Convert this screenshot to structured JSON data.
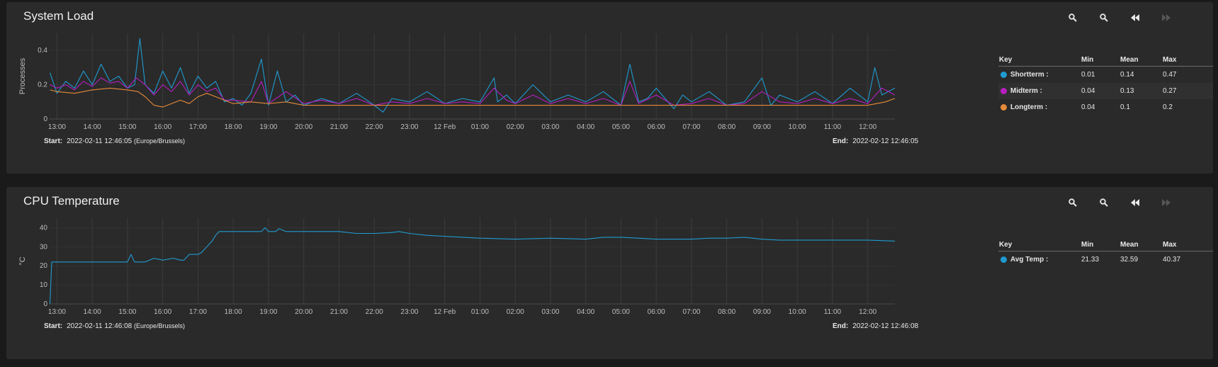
{
  "colors": {
    "shortterm": "#1f9bd1",
    "midterm": "#b61ec0",
    "longterm": "#e68a3a",
    "avgtemp": "#1f9bd1",
    "grid": "#3c3c3c",
    "axis_text": "#bdbdbd"
  },
  "toolbar_icons": [
    "zoom-in-icon",
    "zoom-out-icon",
    "rewind-icon",
    "forward-icon"
  ],
  "panels": [
    {
      "title": "System Load",
      "start_label": "Start:",
      "start_value": "2022-02-11 12:46:05",
      "start_tz": "(Europe/Brussels)",
      "end_label": "End:",
      "end_value": "2022-02-12 12:46:05",
      "legend": {
        "headers": [
          "Key",
          "Min",
          "Mean",
          "Max"
        ],
        "rows": [
          {
            "name": "Shortterm :",
            "min": "0.01",
            "mean": "0.14",
            "max": "0.47",
            "color": "#1f9bd1"
          },
          {
            "name": "Midterm :",
            "min": "0.04",
            "mean": "0.13",
            "max": "0.27",
            "color": "#b61ec0"
          },
          {
            "name": "Longterm :",
            "min": "0.04",
            "mean": "0.1",
            "max": "0.2",
            "color": "#e68a3a"
          }
        ]
      }
    },
    {
      "title": "CPU Temperature",
      "start_label": "Start:",
      "start_value": "2022-02-11 12:46:08",
      "start_tz": "(Europe/Brussels)",
      "end_label": "End:",
      "end_value": "2022-02-12 12:46:08",
      "legend": {
        "headers": [
          "Key",
          "Min",
          "Mean",
          "Max"
        ],
        "rows": [
          {
            "name": "Avg Temp :",
            "min": "21.33",
            "mean": "32.59",
            "max": "40.37",
            "color": "#1f9bd1"
          }
        ]
      }
    }
  ],
  "chart_data": [
    {
      "type": "line",
      "title": "System Load",
      "ylabel": "Processes",
      "ylim": [
        0,
        0.5
      ],
      "yticks": [
        0,
        0.2,
        0.4
      ],
      "ytick_labels": [
        "0",
        "0.2",
        "0.4"
      ],
      "xlim": [
        12.77,
        36.77
      ],
      "xticks": [
        13,
        14,
        15,
        16,
        17,
        18,
        19,
        20,
        21,
        22,
        23,
        24,
        25,
        26,
        27,
        28,
        29,
        30,
        31,
        32,
        33,
        34,
        35,
        36
      ],
      "xtick_labels": [
        "13:00",
        "14:00",
        "15:00",
        "16:00",
        "17:00",
        "18:00",
        "19:00",
        "20:00",
        "21:00",
        "22:00",
        "23:00",
        "12 Feb",
        "01:00",
        "02:00",
        "03:00",
        "04:00",
        "05:00",
        "06:00",
        "07:00",
        "08:00",
        "09:00",
        "10:00",
        "11:00",
        "12:00"
      ],
      "grid": "vertical",
      "series": [
        {
          "name": "Shortterm",
          "color": "#1f9bd1",
          "x": [
            12.8,
            13.0,
            13.25,
            13.5,
            13.75,
            14.0,
            14.25,
            14.5,
            14.75,
            15.0,
            15.2,
            15.35,
            15.5,
            15.75,
            16.0,
            16.25,
            16.5,
            16.75,
            17.0,
            17.25,
            17.5,
            17.75,
            18.0,
            18.25,
            18.5,
            18.8,
            19.0,
            19.25,
            19.5,
            19.75,
            20.0,
            20.5,
            21.0,
            21.5,
            22.0,
            22.25,
            22.5,
            23.0,
            23.5,
            24.0,
            24.5,
            25.0,
            25.4,
            25.5,
            25.75,
            26.0,
            26.5,
            27.0,
            27.5,
            28.0,
            28.5,
            29.0,
            29.25,
            29.5,
            29.75,
            30.0,
            30.5,
            30.75,
            31.0,
            31.5,
            32.0,
            32.5,
            33.0,
            33.25,
            33.5,
            34.0,
            34.5,
            35.0,
            35.5,
            36.0,
            36.2,
            36.4,
            36.77
          ],
          "y": [
            0.27,
            0.15,
            0.22,
            0.18,
            0.28,
            0.2,
            0.32,
            0.22,
            0.25,
            0.18,
            0.2,
            0.47,
            0.2,
            0.15,
            0.28,
            0.18,
            0.3,
            0.15,
            0.25,
            0.18,
            0.22,
            0.1,
            0.12,
            0.08,
            0.15,
            0.35,
            0.08,
            0.28,
            0.1,
            0.14,
            0.08,
            0.12,
            0.09,
            0.15,
            0.08,
            0.04,
            0.12,
            0.1,
            0.16,
            0.09,
            0.12,
            0.1,
            0.24,
            0.1,
            0.14,
            0.09,
            0.2,
            0.1,
            0.14,
            0.1,
            0.16,
            0.08,
            0.32,
            0.1,
            0.12,
            0.18,
            0.06,
            0.14,
            0.1,
            0.16,
            0.08,
            0.1,
            0.24,
            0.08,
            0.14,
            0.1,
            0.16,
            0.09,
            0.18,
            0.1,
            0.3,
            0.14,
            0.18
          ]
        },
        {
          "name": "Midterm",
          "color": "#b61ec0",
          "x": [
            12.8,
            13.0,
            13.25,
            13.5,
            13.75,
            14.0,
            14.25,
            14.5,
            14.75,
            15.0,
            15.25,
            15.5,
            15.75,
            16.0,
            16.25,
            16.5,
            16.75,
            17.0,
            17.25,
            17.5,
            17.75,
            18.0,
            18.5,
            18.8,
            19.0,
            19.5,
            20.0,
            20.5,
            21.0,
            21.5,
            22.0,
            22.5,
            23.0,
            23.5,
            24.0,
            24.5,
            25.0,
            25.4,
            25.75,
            26.0,
            26.5,
            27.0,
            27.5,
            28.0,
            28.5,
            29.0,
            29.25,
            29.5,
            30.0,
            30.5,
            31.0,
            31.5,
            32.0,
            32.5,
            33.0,
            33.5,
            34.0,
            34.5,
            35.0,
            35.5,
            36.0,
            36.4,
            36.77
          ],
          "y": [
            0.2,
            0.18,
            0.2,
            0.17,
            0.22,
            0.19,
            0.24,
            0.21,
            0.22,
            0.18,
            0.24,
            0.2,
            0.14,
            0.2,
            0.16,
            0.22,
            0.14,
            0.2,
            0.16,
            0.18,
            0.11,
            0.11,
            0.1,
            0.22,
            0.09,
            0.16,
            0.09,
            0.11,
            0.09,
            0.12,
            0.08,
            0.1,
            0.09,
            0.12,
            0.09,
            0.1,
            0.09,
            0.18,
            0.11,
            0.09,
            0.14,
            0.09,
            0.12,
            0.09,
            0.12,
            0.08,
            0.22,
            0.09,
            0.14,
            0.08,
            0.09,
            0.12,
            0.08,
            0.09,
            0.16,
            0.1,
            0.09,
            0.12,
            0.09,
            0.12,
            0.09,
            0.18,
            0.14
          ]
        },
        {
          "name": "Longterm",
          "color": "#e68a3a",
          "x": [
            12.8,
            13.0,
            13.5,
            14.0,
            14.5,
            15.0,
            15.3,
            15.5,
            15.75,
            16.0,
            16.25,
            16.5,
            16.75,
            17.0,
            17.25,
            17.5,
            18.0,
            18.5,
            19.0,
            19.5,
            20.0,
            21.0,
            22.0,
            23.0,
            24.0,
            25.0,
            26.0,
            27.0,
            28.0,
            29.0,
            30.0,
            31.0,
            32.0,
            33.0,
            34.0,
            35.0,
            36.0,
            36.5,
            36.77
          ],
          "y": [
            0.17,
            0.16,
            0.15,
            0.17,
            0.18,
            0.17,
            0.16,
            0.13,
            0.08,
            0.07,
            0.09,
            0.11,
            0.09,
            0.13,
            0.15,
            0.13,
            0.09,
            0.1,
            0.09,
            0.1,
            0.08,
            0.08,
            0.08,
            0.08,
            0.08,
            0.08,
            0.08,
            0.08,
            0.08,
            0.08,
            0.08,
            0.08,
            0.08,
            0.08,
            0.08,
            0.08,
            0.08,
            0.1,
            0.12
          ]
        }
      ]
    },
    {
      "type": "line",
      "title": "CPU Temperature",
      "ylabel": "°C",
      "ylim": [
        0,
        45
      ],
      "yticks": [
        0,
        10,
        20,
        30,
        40
      ],
      "ytick_labels": [
        "0",
        "10",
        "20",
        "30",
        "40"
      ],
      "xlim": [
        12.77,
        36.77
      ],
      "xticks": [
        13,
        14,
        15,
        16,
        17,
        18,
        19,
        20,
        21,
        22,
        23,
        24,
        25,
        26,
        27,
        28,
        29,
        30,
        31,
        32,
        33,
        34,
        35,
        36
      ],
      "xtick_labels": [
        "13:00",
        "14:00",
        "15:00",
        "16:00",
        "17:00",
        "18:00",
        "19:00",
        "20:00",
        "21:00",
        "22:00",
        "23:00",
        "12 Feb",
        "01:00",
        "02:00",
        "03:00",
        "04:00",
        "05:00",
        "06:00",
        "07:00",
        "08:00",
        "09:00",
        "10:00",
        "11:00",
        "12:00"
      ],
      "grid": "vertical",
      "series": [
        {
          "name": "Avg Temp",
          "color": "#1f9bd1",
          "x": [
            12.8,
            12.85,
            13.0,
            13.5,
            14.0,
            14.5,
            15.0,
            15.1,
            15.2,
            15.3,
            15.5,
            15.75,
            16.0,
            16.3,
            16.5,
            16.6,
            16.75,
            17.0,
            17.1,
            17.25,
            17.4,
            17.5,
            17.6,
            17.75,
            18.0,
            18.5,
            18.8,
            18.9,
            19.0,
            19.2,
            19.3,
            19.5,
            20.0,
            20.5,
            21.0,
            21.5,
            22.0,
            22.5,
            22.7,
            23.0,
            23.5,
            24.0,
            25.0,
            26.0,
            27.0,
            28.0,
            28.5,
            29.0,
            29.5,
            30.0,
            30.5,
            31.0,
            31.5,
            32.0,
            32.5,
            33.0,
            33.5,
            34.0,
            35.0,
            36.0,
            36.77
          ],
          "y": [
            0,
            22,
            22,
            22,
            22,
            22,
            22,
            26,
            22,
            22,
            22,
            24,
            23,
            24,
            23,
            23,
            26,
            26,
            27,
            30,
            33,
            36,
            38,
            38,
            38,
            38,
            38,
            40,
            38,
            38,
            39.5,
            38,
            38,
            38,
            38,
            37,
            37,
            37.5,
            38,
            37,
            36,
            35.5,
            34.5,
            34,
            34.5,
            34,
            35,
            35,
            34.5,
            34,
            34,
            34,
            34.5,
            34.5,
            35,
            34,
            33.5,
            33.5,
            33.5,
            33.5,
            33
          ]
        }
      ]
    }
  ]
}
